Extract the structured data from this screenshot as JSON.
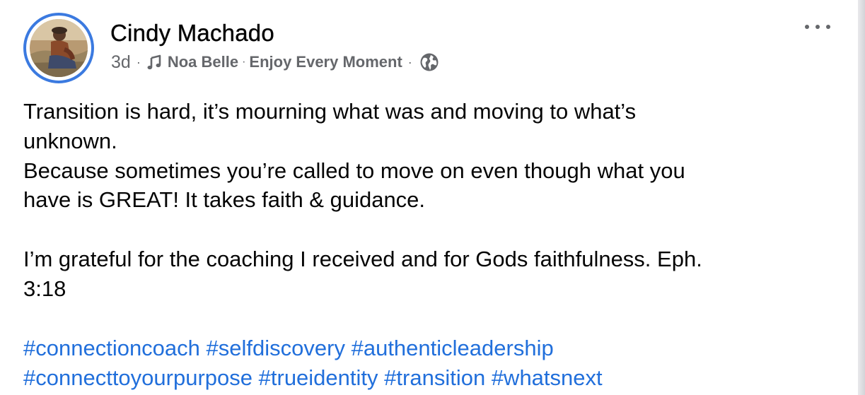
{
  "post": {
    "author": "Cindy Machado",
    "time": "3d",
    "separator": "·",
    "song_artist": "Noa Belle",
    "song_title": "Enjoy Every Moment",
    "icons": {
      "music": "music-note-icon",
      "privacy": "globe-icon",
      "menu": "more-options-icon"
    },
    "text_lines": [
      "Transition is hard, it’s mourning what was and moving to what’s",
      "unknown.",
      "Because sometimes you’re called to move on even though what you",
      "have is GREAT! It takes faith & guidance.",
      "I’m grateful for the coaching I received and for Gods faithfulness. Eph.",
      "3:18"
    ],
    "hashtags": [
      "#connectioncoach",
      "#selfdiscovery",
      "#authenticleadership",
      "#connecttoyourpurpose",
      "#trueidentity",
      "#transition",
      "#whatsnext"
    ]
  },
  "colors": {
    "avatar_ring": "#3b7ae0",
    "hashtag": "#216fdb",
    "meta_text": "#65676b",
    "body_text": "#050505"
  }
}
